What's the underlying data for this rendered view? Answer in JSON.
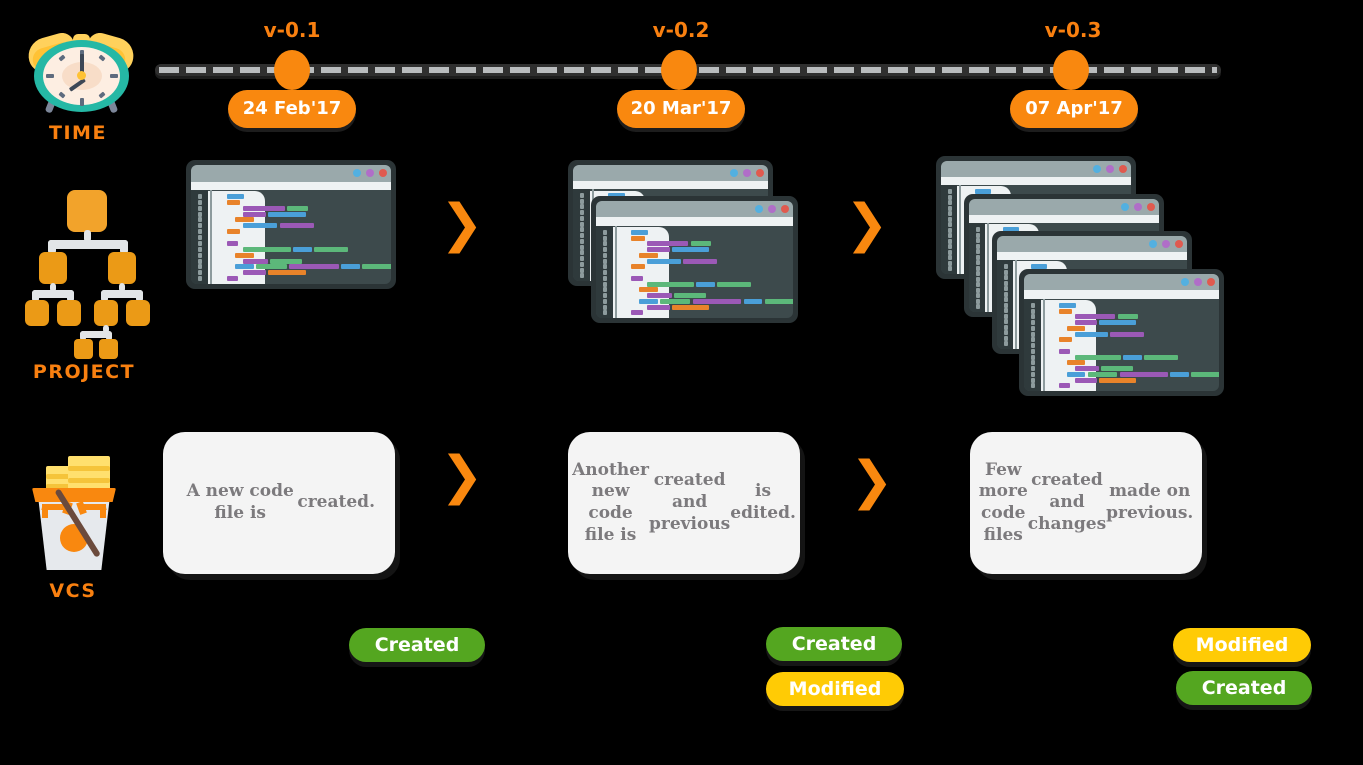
{
  "theme": {
    "background": "#000000",
    "accent_orange": "#f9880f",
    "label_orange": "#f98010",
    "created_green": "#54a620",
    "modified_yellow": "#ffcb05",
    "card_bg": "#f4f4f4",
    "card_text": "#7c7a7d",
    "editor_bg": "#3d4a4c",
    "editor_frame": "#2b3436",
    "timeline_dash": "#b9bcbe"
  },
  "rows": {
    "time": {
      "label": "TIME",
      "icon": "alarm-clock-icon"
    },
    "project": {
      "label": "PROJECT",
      "icon": "org-tree-icon"
    },
    "vcs": {
      "label": "VCS",
      "icon": "version-control-box-icon"
    }
  },
  "timeline": {
    "markers": [
      {
        "version": "v-0.1",
        "date": "24 Feb'17"
      },
      {
        "version": "v-0.2",
        "date": "20 Mar'17"
      },
      {
        "version": "v-0.3",
        "date": "07 Apr'17"
      }
    ]
  },
  "stages": [
    {
      "window_count": 1,
      "description": "A new code file is\ncreated.",
      "badges": [
        {
          "label": "Created",
          "kind": "created"
        }
      ]
    },
    {
      "window_count": 2,
      "description": "Another new code file is\ncreated and previous\nis edited.",
      "badges": [
        {
          "label": "Created",
          "kind": "created"
        },
        {
          "label": "Modified",
          "kind": "modified"
        }
      ]
    },
    {
      "window_count": 4,
      "description": "Few more code files\ncreated and changes\nmade on previous.",
      "badges": [
        {
          "label": "Modified",
          "kind": "modified"
        },
        {
          "label": "Created",
          "kind": "created"
        }
      ]
    }
  ],
  "arrows": {
    "glyph": "❯",
    "count": 4
  },
  "window_chrome": {
    "dots": [
      "#53b0e0",
      "#b06ec8",
      "#e05a4f"
    ]
  },
  "code_palette": {
    "blue": "#4a9fd8",
    "orange": "#e8832a",
    "purple": "#9b59b6",
    "green": "#5cb87a"
  }
}
